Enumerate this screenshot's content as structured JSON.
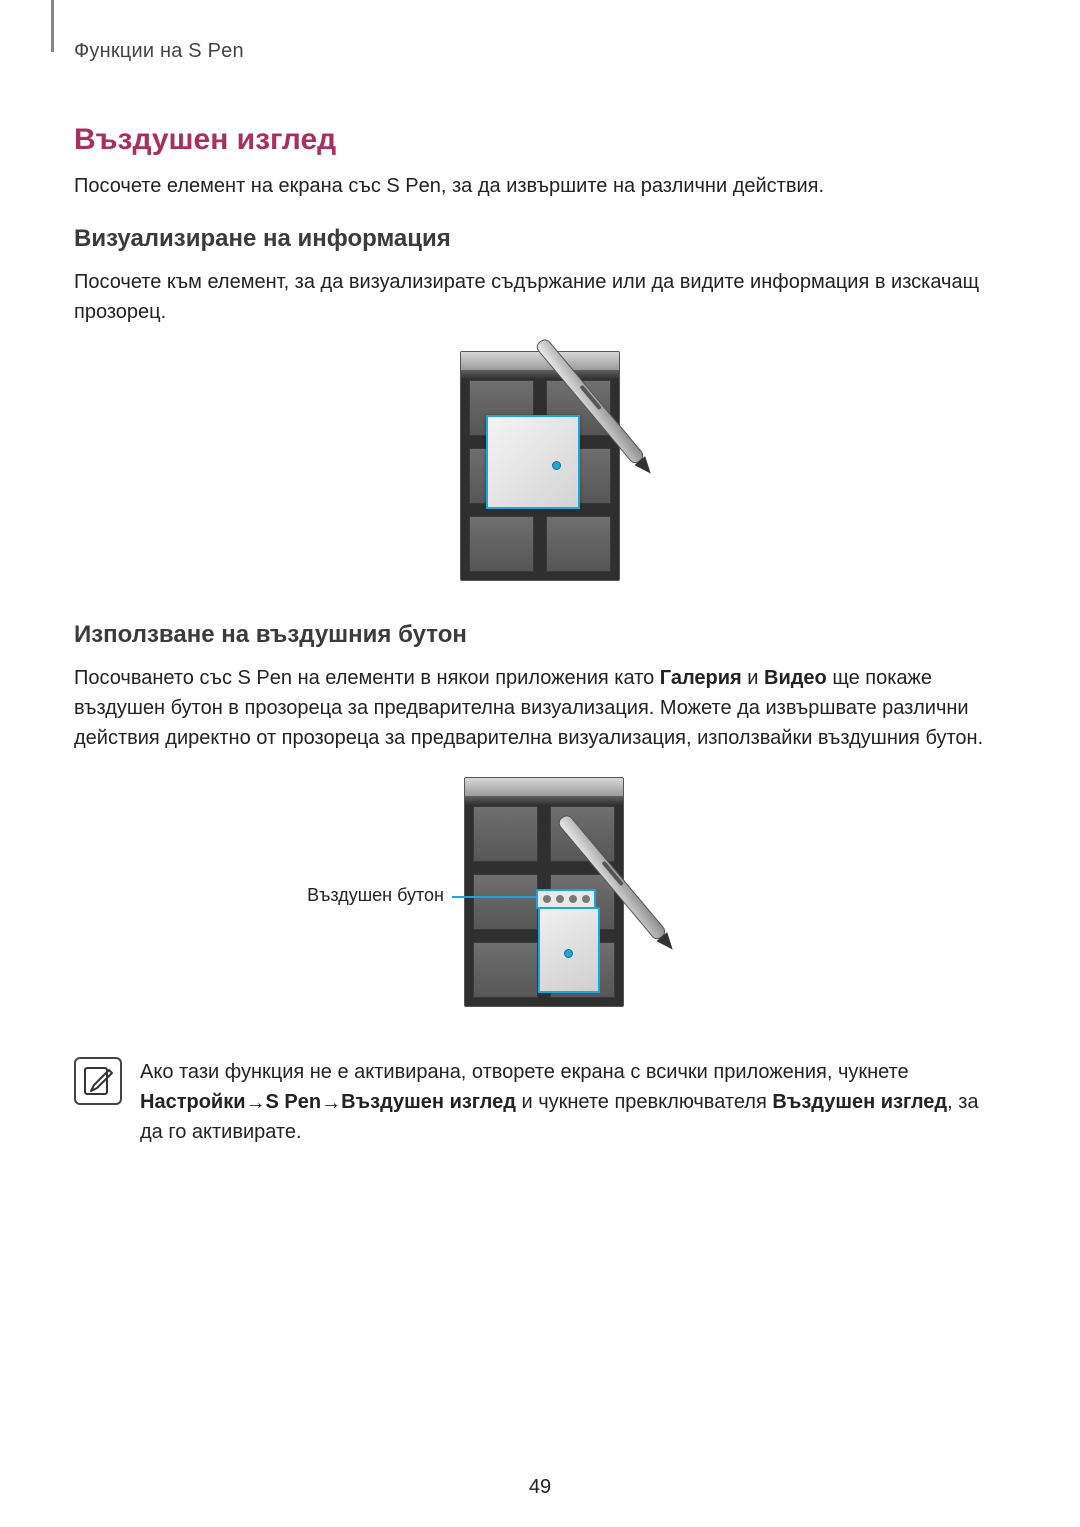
{
  "header": {
    "running_head": "Функции на S Pen"
  },
  "section": {
    "title": "Въздушен изглед",
    "intro": "Посочете елемент на екрана със S Pen, за да извършите на различни действия."
  },
  "sub1": {
    "title": "Визуализиране на информация",
    "text": "Посочете към елемент, за да визуализирате съдържание или да видите информация в изскачащ прозорец."
  },
  "sub2": {
    "title": "Използване на въздушния бутон",
    "text_pre": "Посочването със S Pen на елементи в някои приложения като ",
    "gallery": "Галерия",
    "and": " и ",
    "video": "Видео",
    "text_post": " ще покаже въздушен бутон в прозореца за предварителна визуализация. Можете да извършвате различни действия директно от прозореца за предварителна визуализация, използвайки въздушния бутон.",
    "callout": "Въздушен бутон"
  },
  "note": {
    "pre": "Ако тази функция не е активирана, отворете екрана с всички приложения, чукнете ",
    "settings": "Настройки",
    "arrow": " → ",
    "spen": "S Pen",
    "airview": "Въздушен изглед",
    "mid": " и чукнете превключвателя ",
    "airview2": "Въздушен изглед",
    "post": ", за да го активирате."
  },
  "pagenum": "49"
}
